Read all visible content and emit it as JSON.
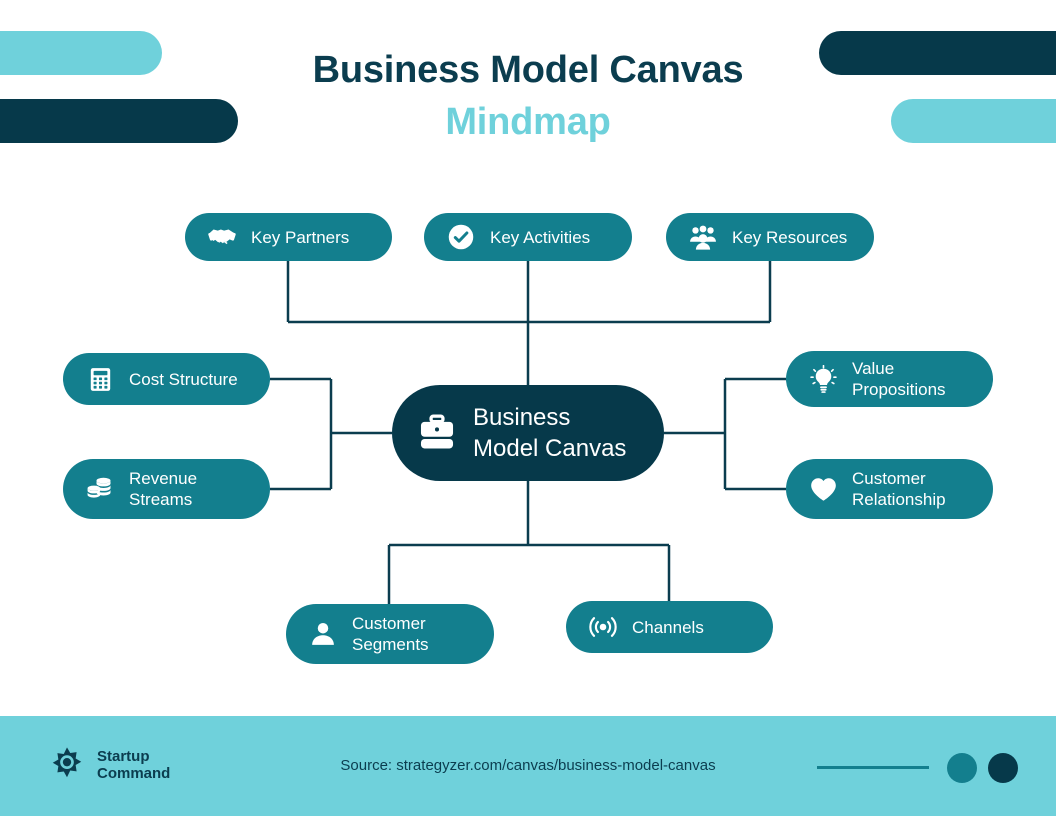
{
  "title": {
    "line1": "Business Model Canvas",
    "line2": "Mindmap"
  },
  "colors": {
    "teal": "#137f8e",
    "dark_navy": "#06394a",
    "light_cyan": "#6fd1db",
    "white": "#ffffff",
    "connector": "#0b3d4f"
  },
  "center_node": {
    "label": "Business\nModel Canvas",
    "icon": "briefcase-icon"
  },
  "nodes": {
    "key_partners": {
      "label": "Key Partners",
      "icon": "handshake-icon"
    },
    "key_activities": {
      "label": "Key Activities",
      "icon": "check-circle-icon"
    },
    "key_resources": {
      "label": "Key Resources",
      "icon": "users-group-icon"
    },
    "cost_structure": {
      "label": "Cost Structure",
      "icon": "calculator-icon"
    },
    "revenue_streams": {
      "label": "Revenue\nStreams",
      "icon": "coins-stack-icon"
    },
    "value_propositions": {
      "label": "Value\nPropositions",
      "icon": "lightbulb-icon"
    },
    "customer_relationship": {
      "label": "Customer\nRelationship",
      "icon": "heart-icon"
    },
    "customer_segments": {
      "label": "Customer\nSegments",
      "icon": "person-icon"
    },
    "channels": {
      "label": "Channels",
      "icon": "broadcast-signal-icon"
    }
  },
  "footer": {
    "brand_name": "Startup\nCommand",
    "brand_icon": "star-badge-logo-icon",
    "source": "Source: strategyzer.com/canvas/business-model-canvas"
  }
}
